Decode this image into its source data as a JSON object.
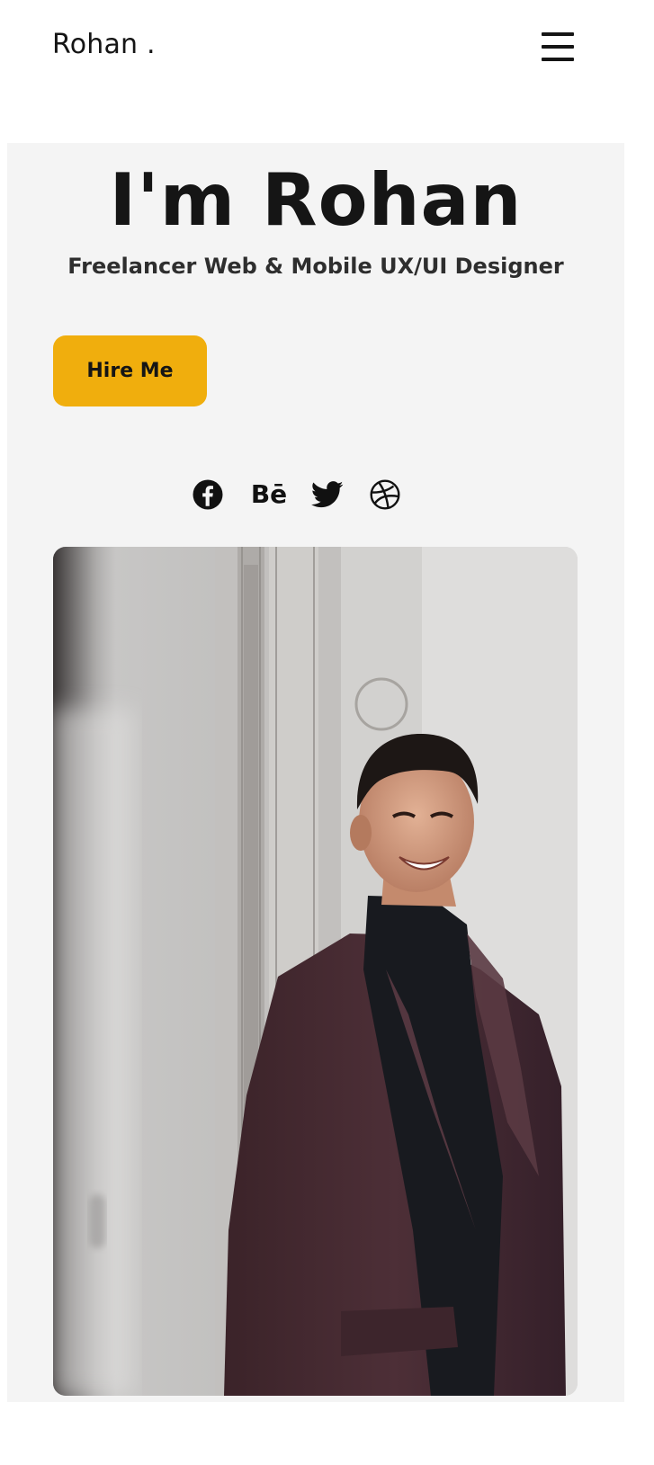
{
  "nav": {
    "logo": "Rohan .",
    "menu_icon": "hamburger-menu-icon"
  },
  "hero": {
    "title": "I'm Rohan",
    "subtitle": "Freelancer Web & Mobile UX/UI Designer",
    "cta_label": "Hire Me"
  },
  "socials": [
    {
      "icon": "facebook-icon"
    },
    {
      "icon": "behance-icon",
      "label": "Bē"
    },
    {
      "icon": "twitter-icon"
    },
    {
      "icon": "dribbble-icon"
    }
  ],
  "colors": {
    "accent": "#f0ae0d",
    "hero_background": "#f4f4f4",
    "text": "#151515"
  }
}
